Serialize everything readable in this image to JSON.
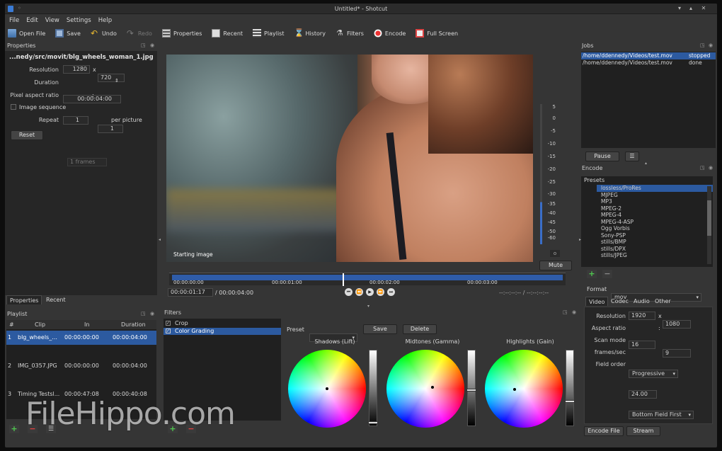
{
  "window": {
    "title": "Untitled* - Shotcut"
  },
  "menu": [
    "File",
    "Edit",
    "View",
    "Settings",
    "Help"
  ],
  "toolbar": {
    "open_file": "Open File",
    "save": "Save",
    "undo": "Undo",
    "redo": "Redo",
    "properties": "Properties",
    "recent": "Recent",
    "playlist": "Playlist",
    "history": "History",
    "filters": "Filters",
    "encode": "Encode",
    "full_screen": "Full Screen"
  },
  "properties": {
    "header": "Properties",
    "filename": "...nedy/src/movit/blg_wheels_woman_1.jpg",
    "resolution_label": "Resolution",
    "res_w": "1280",
    "res_x": "x",
    "res_h": "720",
    "duration_label": "Duration",
    "duration": "00:00:04:00",
    "par_label": "Pixel aspect ratio",
    "par_a": "1",
    "par_colon": ":",
    "par_b": "1",
    "image_sequence": "Image sequence",
    "repeat_label": "Repeat",
    "repeat_value": "1 frames",
    "per_picture": "per picture",
    "reset": "Reset",
    "tabs": [
      "Properties",
      "Recent"
    ]
  },
  "playlist": {
    "header": "Playlist",
    "columns": [
      "#",
      "Clip",
      "In",
      "Duration"
    ],
    "rows": [
      {
        "n": "1",
        "clip": "blg_wheels_...",
        "in": "00:00:00:00",
        "duration": "00:00:04:00"
      },
      {
        "n": "2",
        "clip": "IMG_0357.JPG",
        "in": "00:00:00:00",
        "duration": "00:00:04:00"
      },
      {
        "n": "3",
        "clip": "Timing Testsl...",
        "in": "00:00:47:08",
        "duration": "00:00:40:08"
      }
    ]
  },
  "viewer": {
    "overlay": "Starting image",
    "ticks": [
      "00:00:00:00",
      "00:00:01:00",
      "00:00:02:00",
      "00:00:03:00"
    ],
    "current_time": "00:00:01:17",
    "total_time": "/ 00:00:04:00",
    "in_out": "--:--:--:-- / --:--:--:--"
  },
  "meter": {
    "labels": [
      "5",
      "0",
      "-5",
      "-10",
      "-15",
      "-20",
      "-25",
      "-30",
      "-35",
      "-40",
      "-45",
      "-50",
      "-60"
    ],
    "mute": "Mute"
  },
  "filters": {
    "header": "Filters",
    "items": [
      "Crop",
      "Color Grading"
    ],
    "preset_label": "Preset",
    "save": "Save",
    "delete": "Delete",
    "wheels": [
      "Shadows (Lift)",
      "Midtones (Gamma)",
      "Highlights (Gain)"
    ]
  },
  "jobs": {
    "header": "Jobs",
    "items": [
      {
        "path": "/home/ddennedy/Videos/test.mov",
        "status": "stopped"
      },
      {
        "path": "/home/ddennedy/Videos/test.mov",
        "status": "done"
      }
    ],
    "pause": "Pause"
  },
  "encode": {
    "header": "Encode",
    "presets_label": "Presets",
    "presets": [
      "lossless/ProRes",
      "MJPEG",
      "MP3",
      "MPEG-2",
      "MPEG-4",
      "MPEG-4-ASP",
      "Ogg Vorbis",
      "Sony-PSP",
      "stills/BMP",
      "stills/DPX",
      "stills/JPEG"
    ],
    "format_label": "Format",
    "format_value": "mov",
    "tabs": [
      "Video",
      "Codec",
      "Audio",
      "Other"
    ],
    "resolution_label": "Resolution",
    "res_w": "1920",
    "res_h": "1080",
    "aspect_label": "Aspect ratio",
    "aspect_a": "16",
    "aspect_b": "9",
    "scan_label": "Scan mode",
    "scan_value": "Progressive",
    "fps_label": "frames/sec",
    "fps_value": "24.00",
    "field_label": "Field order",
    "field_value": "Bottom Field First",
    "encode_file": "Encode File",
    "stream": "Stream"
  },
  "watermark": "FileHippo.com"
}
